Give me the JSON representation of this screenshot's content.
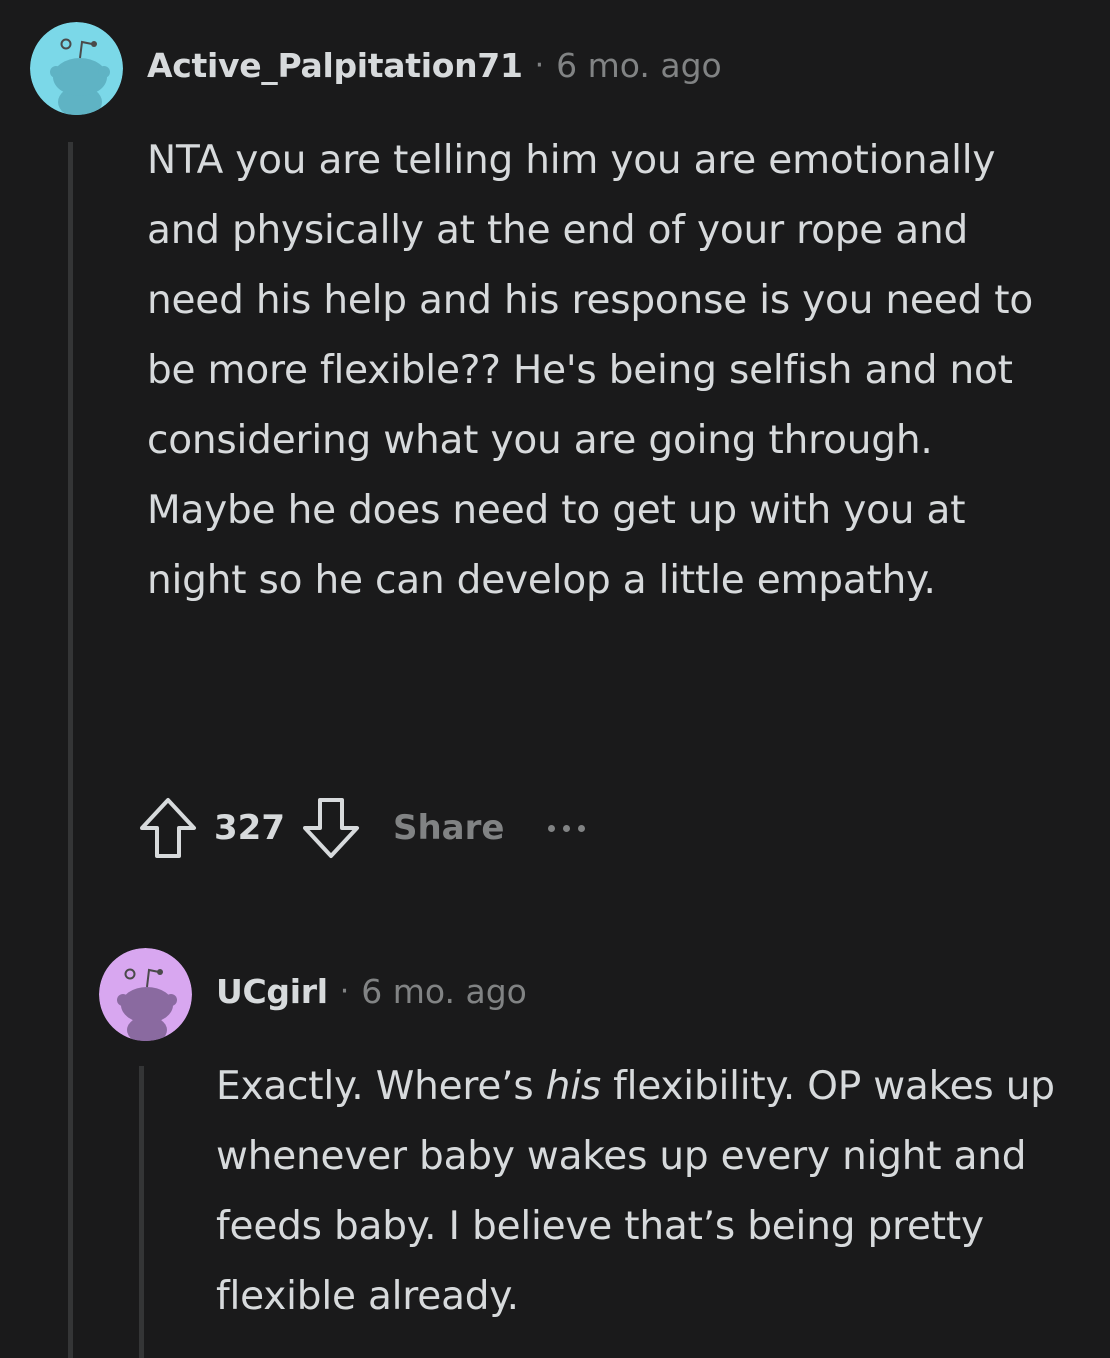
{
  "comments": [
    {
      "username": "Active_Palpitation71",
      "separator": "·",
      "timestamp": "6 mo. ago",
      "avatar_color": "#7bd8e8",
      "body": "NTA you are telling him you are emotionally and physically at the end of your rope and need his help and his response is you need to be more flexible?? He's being selfish and not considering what you are going through. Maybe he does need to get up with you at night so he can develop a little empathy.",
      "score": "327",
      "share_label": "Share",
      "upvote_icon": "arrow-up-outline-icon",
      "downvote_icon": "arrow-down-outline-icon",
      "more_icon": "ellipsis-icon"
    },
    {
      "username": "UCgirl",
      "separator": "·",
      "timestamp": "6 mo. ago",
      "avatar_color": "#d8a7f0",
      "body_parts": [
        "Exactly. Where’s ",
        "his",
        " flexibility. OP wakes up whenever baby wakes up every night and feeds baby. I believe that’s being pretty flexible already."
      ]
    }
  ],
  "colors": {
    "background": "#1a1a1b",
    "text": "#d7dadc",
    "muted": "#818384",
    "thread_line": "#343536"
  }
}
